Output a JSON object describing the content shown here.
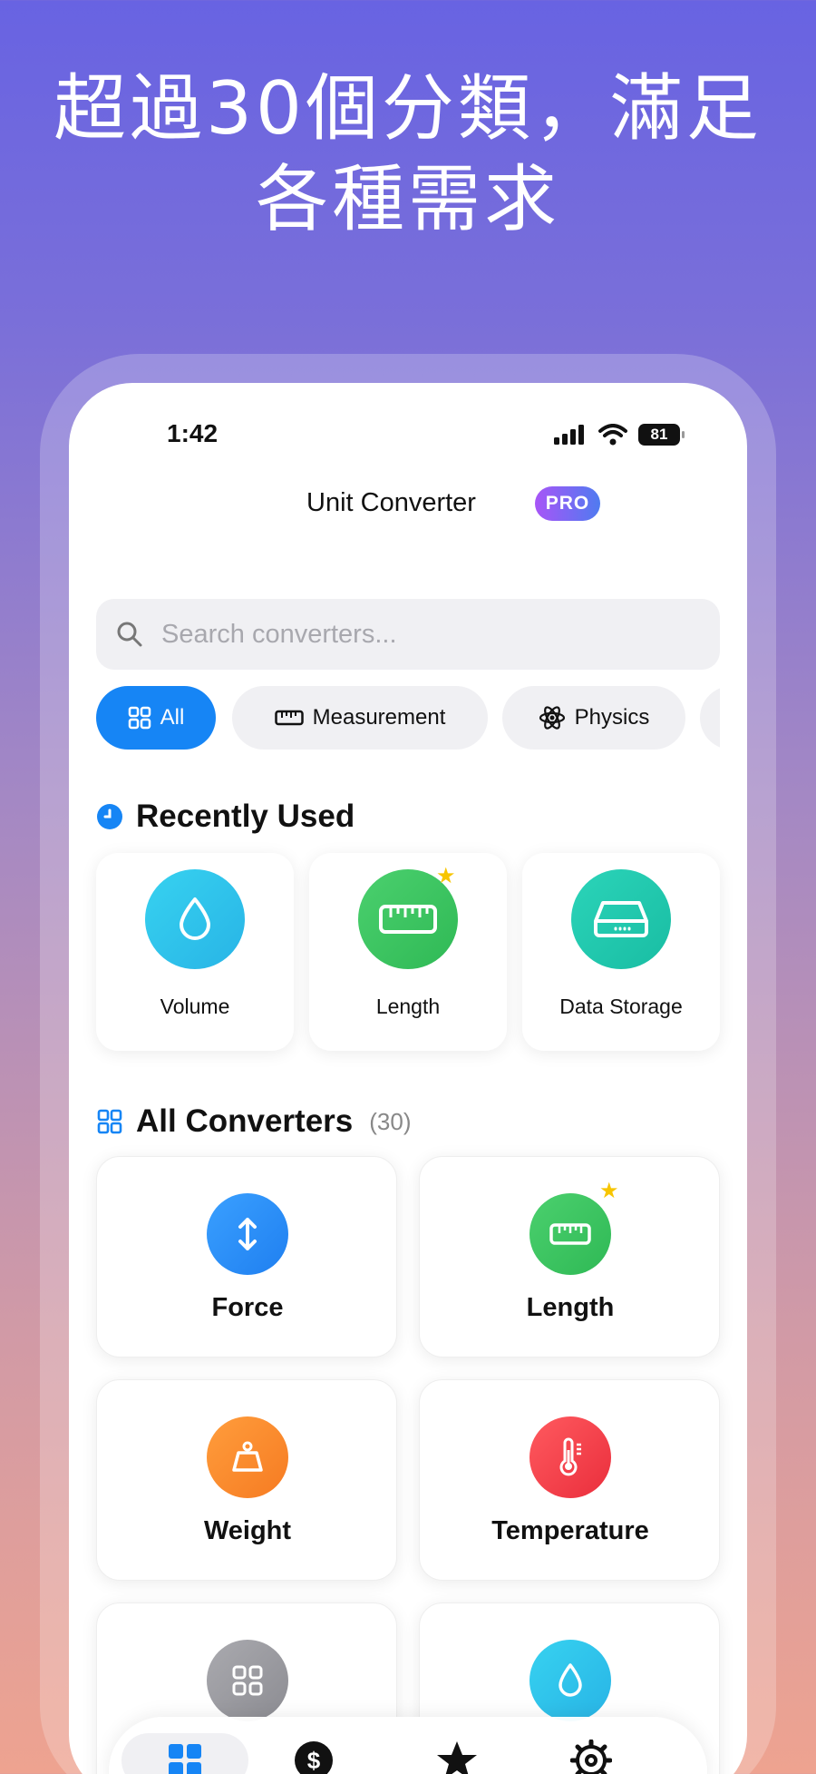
{
  "promo": {
    "line1": "超過30個分類，滿足",
    "line2": "各種需求"
  },
  "status": {
    "time": "1:42",
    "battery": "81"
  },
  "header": {
    "title": "Unit Converter",
    "badge": "PRO"
  },
  "search": {
    "placeholder": "Search converters..."
  },
  "chips": [
    {
      "label": "All",
      "icon": "grid-icon",
      "active": true
    },
    {
      "label": "Measurement",
      "icon": "ruler-icon",
      "active": false
    },
    {
      "label": "Physics",
      "icon": "atom-icon",
      "active": false
    }
  ],
  "recent": {
    "title": "Recently Used",
    "items": [
      {
        "label": "Volume",
        "icon": "drop-icon",
        "color": "#2ec5ea",
        "favorite": false
      },
      {
        "label": "Length",
        "icon": "ruler-icon",
        "color": "#38c562",
        "favorite": true
      },
      {
        "label": "Data Storage",
        "icon": "storage-icon",
        "color": "#20c9b0",
        "favorite": false
      }
    ]
  },
  "all": {
    "title": "All Converters",
    "count": "(30)",
    "items": [
      {
        "label": "Force",
        "icon": "arrows-vertical-icon",
        "color": "#2a8cf5",
        "favorite": false
      },
      {
        "label": "Length",
        "icon": "ruler-icon",
        "color": "#38c562",
        "favorite": true
      },
      {
        "label": "Weight",
        "icon": "weight-icon",
        "color": "#fb8a2c",
        "favorite": false
      },
      {
        "label": "Temperature",
        "icon": "thermometer-icon",
        "color": "#f2404a",
        "favorite": false
      },
      {
        "label": "",
        "icon": "grid-icon",
        "color": "#9a9a9e",
        "favorite": false
      },
      {
        "label": "",
        "icon": "drop-icon",
        "color": "#2ec5ea",
        "favorite": false
      }
    ]
  },
  "tabbar": [
    {
      "icon": "grid-icon",
      "active": true,
      "color": "#1685f5"
    },
    {
      "icon": "dollar-icon",
      "active": false,
      "color": "#111111"
    },
    {
      "icon": "star-icon",
      "active": false,
      "color": "#111111"
    },
    {
      "icon": "gear-icon",
      "active": false,
      "color": "#111111"
    }
  ]
}
